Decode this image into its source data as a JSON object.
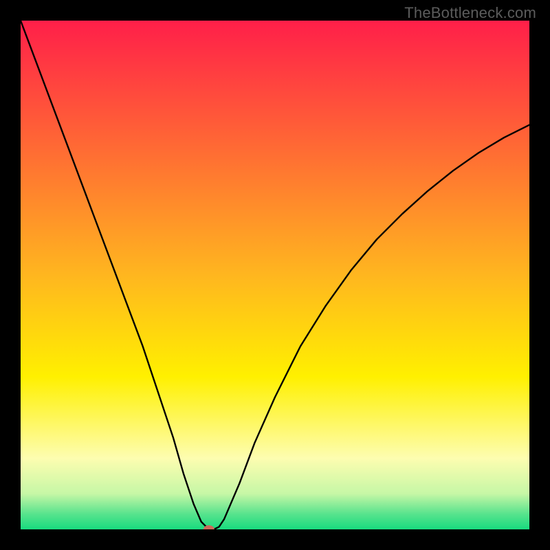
{
  "attribution": "TheBottleneck.com",
  "chart_data": {
    "type": "line",
    "title": "",
    "xlabel": "",
    "ylabel": "",
    "xlim": [
      0,
      100
    ],
    "ylim": [
      0,
      100
    ],
    "grid": false,
    "legend": false,
    "background_gradient_stops": [
      {
        "offset": 0.0,
        "color": "#ff1f49"
      },
      {
        "offset": 0.25,
        "color": "#ff6a34"
      },
      {
        "offset": 0.5,
        "color": "#ffb61f"
      },
      {
        "offset": 0.7,
        "color": "#fff000"
      },
      {
        "offset": 0.86,
        "color": "#fdfdb0"
      },
      {
        "offset": 0.93,
        "color": "#c6f7a6"
      },
      {
        "offset": 0.97,
        "color": "#57e38d"
      },
      {
        "offset": 1.0,
        "color": "#18db7e"
      }
    ],
    "series": [
      {
        "name": "bottleneck-curve",
        "stroke": "#000000",
        "stroke_width": 2.4,
        "x": [
          0,
          3,
          6,
          9,
          12,
          15,
          18,
          21,
          24,
          27,
          30,
          32,
          34,
          35.5,
          37,
          38,
          39,
          40,
          43,
          46,
          50,
          55,
          60,
          65,
          70,
          75,
          80,
          85,
          90,
          95,
          100
        ],
        "y": [
          100,
          92,
          84,
          76,
          68,
          60,
          52,
          44,
          36,
          27,
          18,
          11,
          5,
          1.5,
          0,
          0,
          0.5,
          2,
          9,
          17,
          26,
          36,
          44,
          51,
          57,
          62,
          66.5,
          70.5,
          74,
          77,
          79.5
        ]
      }
    ],
    "marker": {
      "x": 37,
      "y": 0,
      "color": "#cc6a5a",
      "rx": 8,
      "ry": 6
    }
  }
}
